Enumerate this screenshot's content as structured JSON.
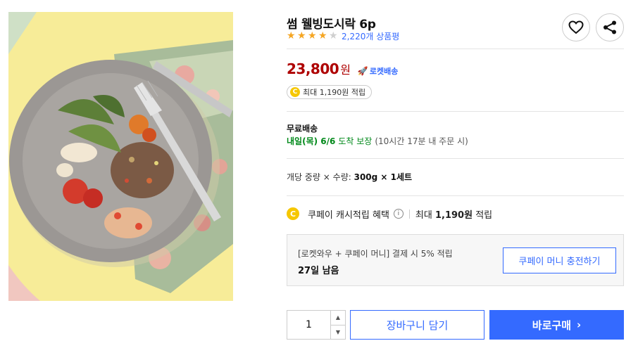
{
  "product": {
    "title": "썸 웰빙도시락 6p",
    "rating": 4,
    "rating_max": 5,
    "review_count": "2,220개 상품평"
  },
  "actions": {
    "wishlist_icon": "heart-icon",
    "share_icon": "share-icon"
  },
  "price": {
    "value": "23,800",
    "unit": "원",
    "rocket_label": "로켓배송"
  },
  "cashback": {
    "text": "최대 1,190원 적립"
  },
  "shipping": {
    "label": "무료배송",
    "date": "내일(목) 6/6",
    "guarantee": "도착 보장",
    "cutoff": "(10시간 17분 내 주문 시)"
  },
  "option": {
    "label": "개당 중량 × 수량: ",
    "value": "300g × 1세트"
  },
  "coupay": {
    "label": "쿠페이 캐시적립 혜택",
    "amount_prefix": "최대 ",
    "amount": "1,190원",
    "amount_suffix": " 적립"
  },
  "promo": {
    "line1": "[로켓와우 + 쿠페이 머니] 결제 시 5% 적립",
    "line2": "27일 남음",
    "charge_button": "쿠페이 머니 충전하기"
  },
  "purchase": {
    "quantity": "1",
    "cart_button": "장바구니 담기",
    "buy_button": "바로구매"
  },
  "colors": {
    "accent": "#346aff",
    "price": "#ae0000",
    "delivery": "#00891a",
    "star": "#f5a623",
    "image_bg": "#f7ec98"
  }
}
